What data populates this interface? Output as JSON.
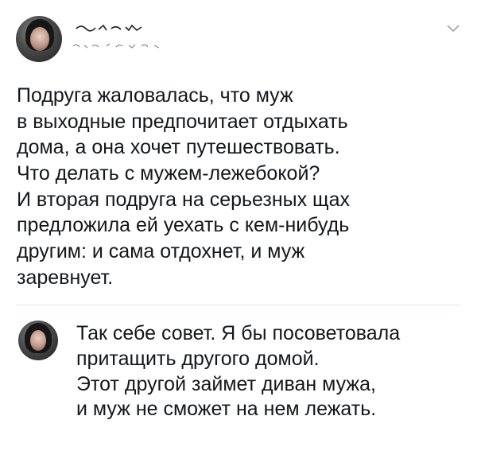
{
  "tweet": {
    "author_name": "",
    "author_handle": "",
    "menu_icon": "chevron-down-icon",
    "lines": [
      "Подруга жаловалась, что муж",
      "в выходные предпочитает отдыхать",
      "дома, а она хочет путешествовать.",
      "Что делать с мужем-лежебокой?",
      "И вторая подруга на серьезных щах",
      "предложила ей уехать с кем-нибудь",
      "другим: и сама отдохнет, и муж",
      "заревнует."
    ]
  },
  "reply": {
    "lines": [
      "Так себе совет. Я бы посоветовала",
      "притащить другого домой.",
      "Этот другой займет диван мужа,",
      "и муж не сможет на нем лежать."
    ]
  },
  "colors": {
    "text": "#14171a",
    "divider": "#e1e8ed",
    "chevron": "#9aa4ad"
  }
}
